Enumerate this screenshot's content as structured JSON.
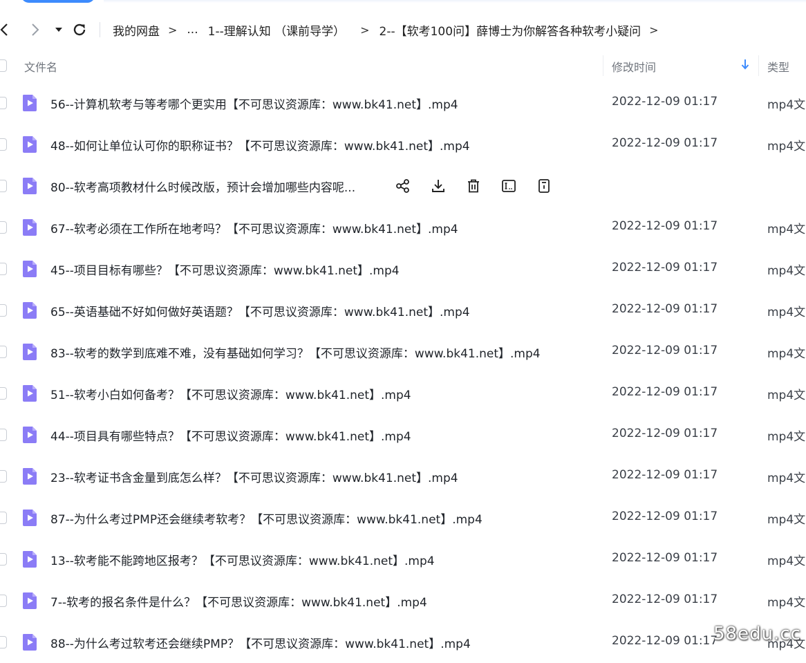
{
  "toolbar": {
    "back_icon": "chevron-left-icon",
    "forward_icon": "chevron-right-icon",
    "history_icon": "caret-down-icon",
    "refresh_icon": "refresh-icon"
  },
  "breadcrumb": {
    "items": [
      "我的网盘",
      "...",
      "1--理解认知 （课前导学）",
      "2--【软考100问】薛博士为你解答各种软考小疑问"
    ],
    "arrow": ">"
  },
  "columns": {
    "name": "文件名",
    "modified": "修改时间",
    "type": "类型",
    "sort_icon": "sort-down-arrow-icon"
  },
  "files": [
    {
      "name": "56--计算机软考与等考哪个更实用【不可思议资源库：www.bk41.net】.mp4",
      "time": "2022-12-09 01:17",
      "type": "mp4文"
    },
    {
      "name": "48--如何让单位认可你的职称证书？【不可思议资源库：www.bk41.net】.mp4",
      "time": "2022-12-09 01:17",
      "type": "mp4文"
    },
    {
      "name": "80--软考高项教材什么时候改版，预计会增加哪些内容呢...",
      "time": "",
      "type": "",
      "hovered": true
    },
    {
      "name": "67--软考必须在工作所在地考吗？【不可思议资源库：www.bk41.net】.mp4",
      "time": "2022-12-09 01:17",
      "type": "mp4文"
    },
    {
      "name": "45--项目目标有哪些？【不可思议资源库：www.bk41.net】.mp4",
      "time": "2022-12-09 01:17",
      "type": "mp4文"
    },
    {
      "name": "65--英语基础不好如何做好英语题？【不可思议资源库：www.bk41.net】.mp4",
      "time": "2022-12-09 01:17",
      "type": "mp4文"
    },
    {
      "name": "83--软考的数学到底难不难，没有基础如何学习？【不可思议资源库：www.bk41.net】.mp4",
      "time": "2022-12-09 01:17",
      "type": "mp4文"
    },
    {
      "name": "51--软考小白如何备考？【不可思议资源库：www.bk41.net】.mp4",
      "time": "2022-12-09 01:17",
      "type": "mp4文"
    },
    {
      "name": "44--项目具有哪些特点？【不可思议资源库：www.bk41.net】.mp4",
      "time": "2022-12-09 01:17",
      "type": "mp4文"
    },
    {
      "name": "23--软考证书含金量到底怎么样？【不可思议资源库：www.bk41.net】.mp4",
      "time": "2022-12-09 01:17",
      "type": "mp4文"
    },
    {
      "name": "87--为什么考过PMP还会继续考软考？【不可思议资源库：www.bk41.net】.mp4",
      "time": "2022-12-09 01:17",
      "type": "mp4文"
    },
    {
      "name": "13--软考能不能跨地区报考？【不可思议资源库：www.bk41.net】.mp4",
      "time": "2022-12-09 01:17",
      "type": "mp4文"
    },
    {
      "name": "7--软考的报名条件是什么？【不可思议资源库：www.bk41.net】.mp4",
      "time": "2022-12-09 01:17",
      "type": "mp4文"
    },
    {
      "name": "88--为什么考过软考还会继续PMP？【不可思议资源库：www.bk41.net】.mp4",
      "time": "2022-12-09 01:17",
      "type": "mp4文"
    }
  ],
  "row_actions": [
    "share-icon",
    "download-icon",
    "delete-icon",
    "rename-icon",
    "more-info-icon"
  ],
  "file_icon": "video-file-icon",
  "colors": {
    "accent": "#3d8bfd",
    "file_icon": "#8b7cf6"
  },
  "watermark": "58edu.cc"
}
